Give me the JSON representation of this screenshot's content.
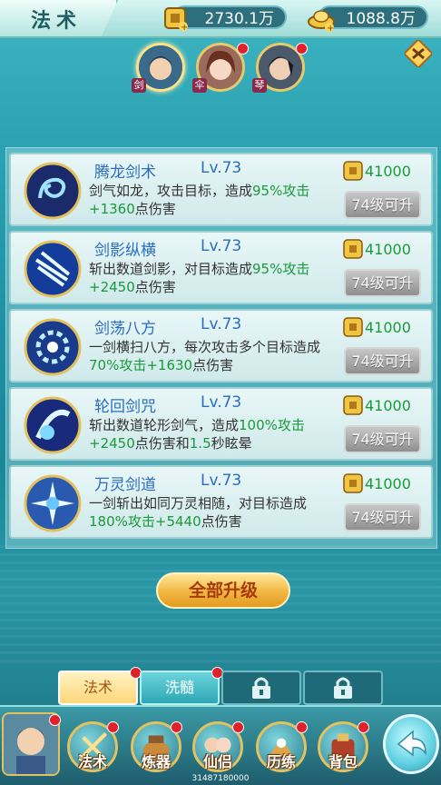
{
  "header": {
    "title": "法术",
    "silver": "2730.1万",
    "gold": "1088.8万"
  },
  "characters": [
    {
      "tag": "剑",
      "badge": false,
      "selected": true
    },
    {
      "tag": "伞",
      "badge": true,
      "selected": false
    },
    {
      "tag": "琴",
      "badge": true,
      "selected": false
    }
  ],
  "skills": [
    {
      "name": "腾龙剑术",
      "level": "Lv.73",
      "cost": "41000",
      "button": "74级可升",
      "desc": [
        [
          "剑气如龙，攻击目标，造成",
          ""
        ],
        [
          "95%攻击+1360",
          "g"
        ],
        [
          "点伤害",
          ""
        ]
      ]
    },
    {
      "name": "剑影纵横",
      "level": "Lv.73",
      "cost": "41000",
      "button": "74级可升",
      "desc": [
        [
          "斩出数道剑影，对目标造成",
          ""
        ],
        [
          "95%攻击+2450",
          "g"
        ],
        [
          "点伤害",
          ""
        ]
      ]
    },
    {
      "name": "剑荡八方",
      "level": "Lv.73",
      "cost": "41000",
      "button": "74级可升",
      "desc": [
        [
          "一剑横扫八方，每次攻击多个目标造成",
          ""
        ],
        [
          "70%攻击+1630",
          "g"
        ],
        [
          "点伤害",
          ""
        ]
      ]
    },
    {
      "name": "轮回剑咒",
      "level": "Lv.73",
      "cost": "41000",
      "button": "74级可升",
      "desc": [
        [
          "斩出数道轮形剑气，造成",
          ""
        ],
        [
          "100%攻击+2450",
          "g"
        ],
        [
          "点伤害和",
          ""
        ],
        [
          "1.5",
          "g"
        ],
        [
          "秒眩晕",
          ""
        ]
      ]
    },
    {
      "name": "万灵剑道",
      "level": "Lv.73",
      "cost": "41000",
      "button": "74级可升",
      "desc": [
        [
          "一剑斩出如同万灵相随，对目标造成",
          ""
        ],
        [
          "180%攻击+5440",
          "g"
        ],
        [
          "点伤害",
          ""
        ]
      ]
    }
  ],
  "upgrade_all": "全部升级",
  "tabs": [
    {
      "label": "法术",
      "badge": true,
      "locked": false
    },
    {
      "label": "洗髓",
      "badge": true,
      "locked": false
    },
    {
      "label": "",
      "badge": false,
      "locked": true
    },
    {
      "label": "",
      "badge": false,
      "locked": true
    }
  ],
  "nav": [
    {
      "label": "法术",
      "icon": "sword-icon",
      "badge": true
    },
    {
      "label": "炼器",
      "icon": "cauldron-icon",
      "badge": true
    },
    {
      "label": "仙侣",
      "icon": "companion-icon",
      "badge": true
    },
    {
      "label": "历练",
      "icon": "training-icon",
      "badge": true
    },
    {
      "label": "背包",
      "icon": "bag-icon",
      "badge": true
    }
  ],
  "footer_text": "31487180000",
  "colors": {
    "accent_green": "#1a9a3a",
    "skill_blue": "#2a6ec2",
    "badge_red": "#e0202a"
  }
}
